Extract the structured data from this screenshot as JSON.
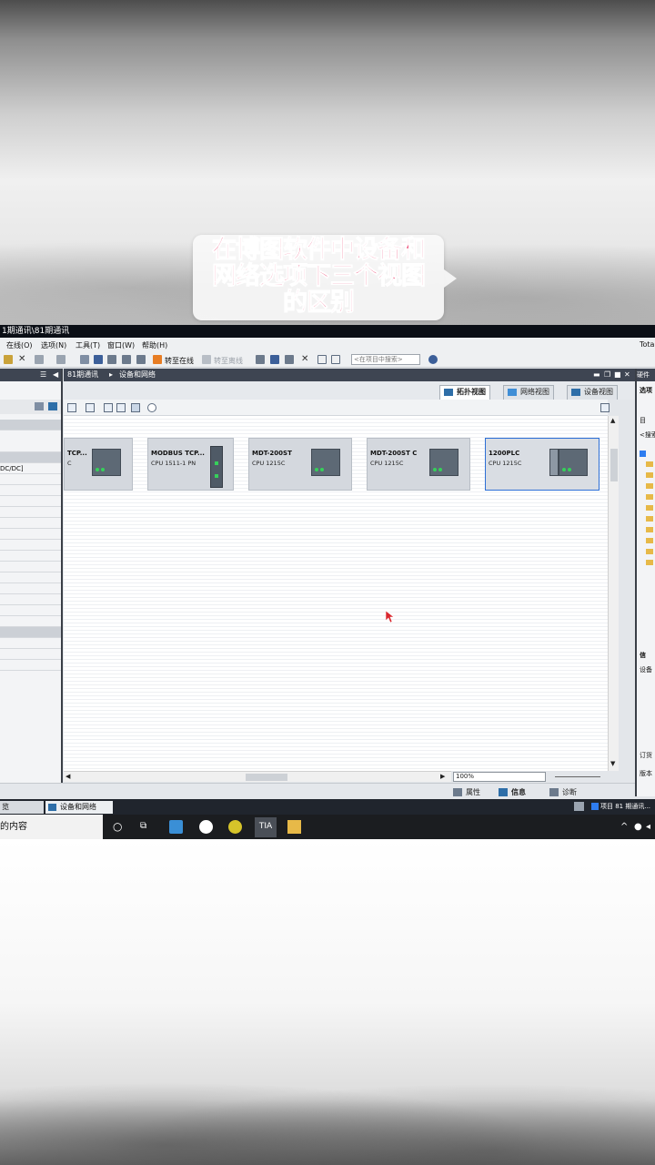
{
  "overlay": {
    "caption": "在博图软件中设备和\n网络选项下三个视图\n的区别"
  },
  "window": {
    "title": "1期通讯\\81期通讯"
  },
  "menu": {
    "items": [
      "在线(O)",
      "选项(N)",
      "工具(T)",
      "窗口(W)",
      "帮助(H)"
    ],
    "right_text": "Tota"
  },
  "toolbar": {
    "go_online": "转至在线",
    "go_offline": "转至离线",
    "search_placeholder": "<在项目中搜索>"
  },
  "editor": {
    "breadcrumb_root": "81期通讯",
    "breadcrumb_sep": "▸",
    "breadcrumb_page": "设备和网络",
    "tabs": [
      {
        "label": "拓扑视图",
        "active": true
      },
      {
        "label": "网络视图",
        "active": false
      },
      {
        "label": "设备视图",
        "active": false
      }
    ],
    "zoom": "100%"
  },
  "devices": [
    {
      "name": "TCP...",
      "cpu": "C",
      "selected": false
    },
    {
      "name": "MODBUS TCP...",
      "cpu": "CPU 1511-1 PN",
      "selected": false
    },
    {
      "name": "MDT-200ST",
      "cpu": "CPU 1215C",
      "selected": false
    },
    {
      "name": "MDT-200ST C",
      "cpu": "CPU 1215C",
      "selected": false
    },
    {
      "name": "1200PLC",
      "cpu": "CPU 1215C",
      "selected": true
    }
  ],
  "left_panel": {
    "item_label": "DC/DC]"
  },
  "right_panel": {
    "header": "硬件",
    "option_label": "选项",
    "search_label": "<搜索",
    "catalog_label": "目",
    "info_header": "信",
    "device_label": "设备",
    "order_label": "订货",
    "version_label": "版本"
  },
  "statusbar": {
    "properties": "属性",
    "info": "信息",
    "diagnostics": "诊断"
  },
  "portal": {
    "left_tab": "览",
    "active_tab": "设备和网络",
    "project_status": "项目 81 期通讯..."
  },
  "taskbar": {
    "search_text": "的内容",
    "tia_label": "TIA"
  },
  "colors": {
    "caption": "#e8114a",
    "header_dark": "#3e4552",
    "selection": "#2d6fd6",
    "led": "#36d05a"
  }
}
